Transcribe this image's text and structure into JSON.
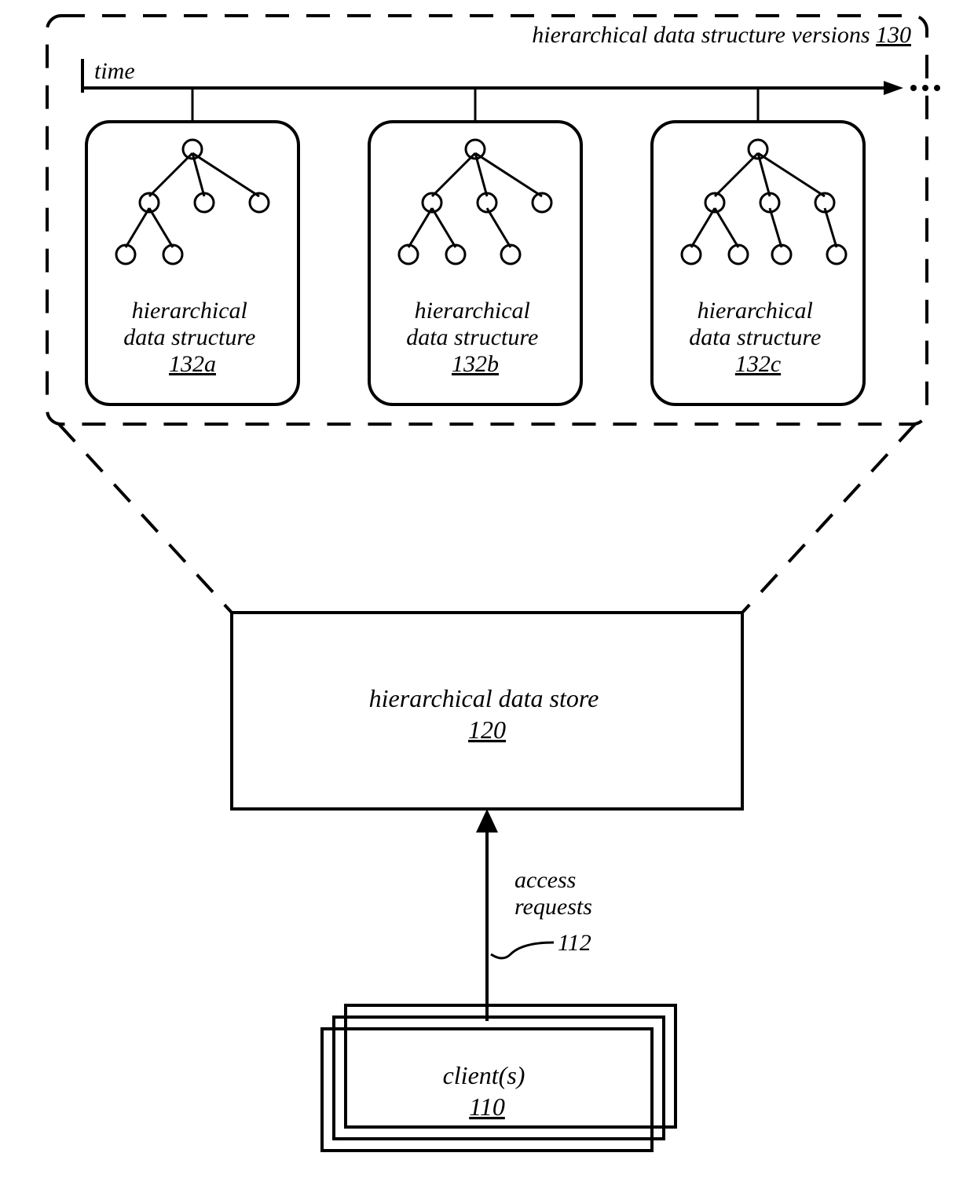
{
  "versions": {
    "title": "hierarchical data structure versions",
    "ref": "130",
    "time_label": "time",
    "items": [
      {
        "label_line1": "hierarchical",
        "label_line2": "data structure",
        "ref": "132a",
        "extra_node": false
      },
      {
        "label_line1": "hierarchical",
        "label_line2": "data structure",
        "ref": "132b",
        "extra_node": true
      },
      {
        "label_line1": "hierarchical",
        "label_line2": "data structure",
        "ref": "132c",
        "extra_node": true
      }
    ]
  },
  "store": {
    "label": "hierarchical data store",
    "ref": "120"
  },
  "access": {
    "label_line1": "access",
    "label_line2": "requests",
    "ref": "112"
  },
  "clients": {
    "label": "client(s)",
    "ref": "110"
  }
}
